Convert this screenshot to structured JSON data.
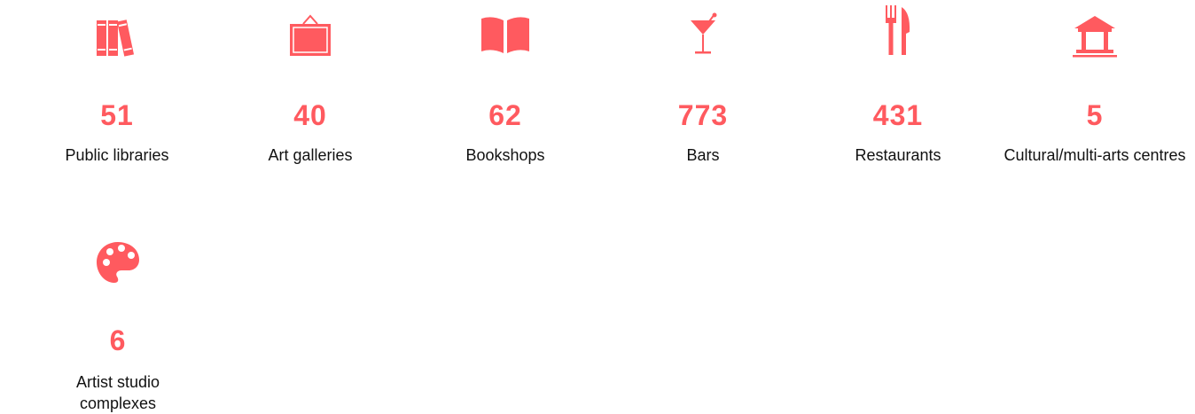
{
  "accent_color": "#ff5a5f",
  "stats": [
    {
      "icon": "books-icon",
      "value": "51",
      "label": "Public libraries"
    },
    {
      "icon": "picture-frame-icon",
      "value": "40",
      "label": "Art galleries"
    },
    {
      "icon": "open-book-icon",
      "value": "62",
      "label": "Bookshops"
    },
    {
      "icon": "cocktail-glass-icon",
      "value": "773",
      "label": "Bars"
    },
    {
      "icon": "fork-knife-icon",
      "value": "431",
      "label": "Restaurants"
    },
    {
      "icon": "building-columns-icon",
      "value": "5",
      "label": "Cultural/multi-arts centres"
    },
    {
      "icon": "palette-icon",
      "value": "6",
      "label": "Artist studio complexes"
    }
  ]
}
